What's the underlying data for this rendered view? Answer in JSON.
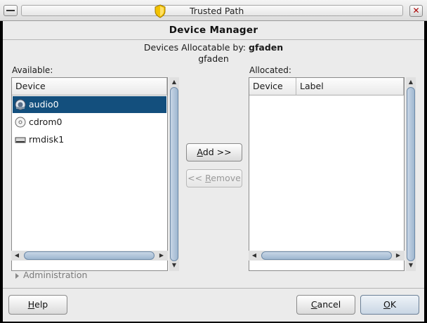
{
  "window": {
    "title": "Trusted Path",
    "close_glyph": "✕",
    "shield_icon": "shield-icon"
  },
  "dialog": {
    "header": "Device Manager",
    "allocatable_prefix": "Devices Allocatable by: ",
    "allocatable_user": "gfaden",
    "user_line": "gfaden"
  },
  "available": {
    "label": "Available:",
    "column": "Device",
    "items": [
      {
        "label": "audio0",
        "icon": "audio-icon",
        "selected": true
      },
      {
        "label": "cdrom0",
        "icon": "cdrom-icon",
        "selected": false
      },
      {
        "label": "rmdisk1",
        "icon": "removable-disk-icon",
        "selected": false
      }
    ]
  },
  "allocated": {
    "label": "Allocated:",
    "columns": [
      "Device",
      "Label"
    ],
    "items": []
  },
  "buttons": {
    "add": {
      "mnemonic": "A",
      "rest": "dd >>"
    },
    "remove": {
      "prefix": "<< ",
      "mnemonic": "R",
      "rest": "emove"
    },
    "help": {
      "mnemonic": "H",
      "rest": "elp"
    },
    "cancel": {
      "mnemonic": "C",
      "rest": "ancel"
    },
    "ok": {
      "mnemonic": "O",
      "rest": "K"
    }
  },
  "administration": {
    "label": "Administration"
  },
  "colors": {
    "selection": "#134f7d",
    "panel": "#ebebeb",
    "scroll_thumb": "#9fb7d0"
  }
}
